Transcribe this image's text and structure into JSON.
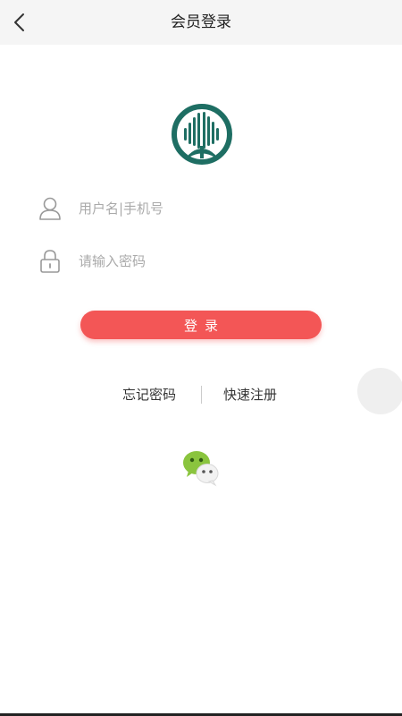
{
  "header": {
    "title": "会员登录",
    "back_icon": "chevron-left-icon"
  },
  "logo": {
    "icon": "tree-logo-icon",
    "color": "#1e6e63"
  },
  "form": {
    "username": {
      "placeholder": "用户名|手机号",
      "value": "",
      "icon": "user-icon"
    },
    "password": {
      "placeholder": "请输入密码",
      "value": "",
      "icon": "lock-icon"
    },
    "login_label": "登录"
  },
  "links": {
    "forgot_password": "忘记密码",
    "register": "快速注册"
  },
  "social": {
    "wechat_icon": "wechat-icon",
    "wechat_color": "#8ac43e"
  },
  "colors": {
    "accent": "#f35656",
    "header_bg": "#f5f5f5"
  }
}
